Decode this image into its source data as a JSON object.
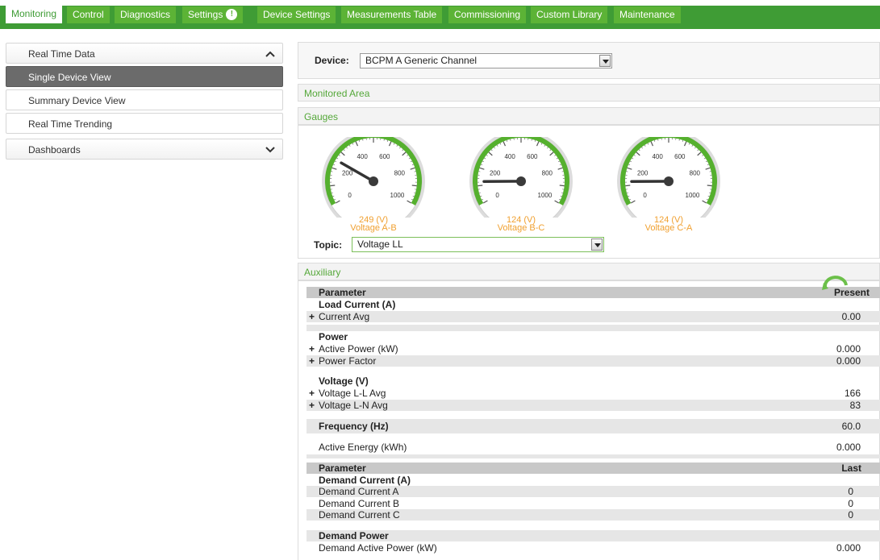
{
  "tabs": [
    {
      "label": "Monitoring",
      "active": true
    },
    {
      "label": "Control"
    },
    {
      "label": "Diagnostics"
    },
    {
      "label": "Settings",
      "badge": "!"
    },
    {
      "label": "Device Settings"
    },
    {
      "label": "Measurements Table"
    },
    {
      "label": "Commissioning"
    },
    {
      "label": "Custom Library"
    },
    {
      "label": "Maintenance"
    }
  ],
  "sidebar": {
    "realtime": "Real Time Data",
    "single": "Single Device View",
    "summary": "Summary Device View",
    "trending": "Real Time Trending",
    "dashboards": "Dashboards"
  },
  "device": {
    "label": "Device:",
    "value": "BCPM A Generic Channel"
  },
  "sections": {
    "monitored": "Monitored Area",
    "gauges": "Gauges",
    "auxiliary": "Auxiliary"
  },
  "gauges": [
    {
      "ticks": [
        "0",
        "200",
        "400",
        "600",
        "800",
        "1000"
      ],
      "value": 249,
      "reading": "249 (V)",
      "name": "Voltage A-B",
      "max": 1000
    },
    {
      "ticks": [
        "0",
        "200",
        "400",
        "600",
        "800",
        "1000"
      ],
      "value": 124,
      "reading": "124 (V)",
      "name": "Voltage B-C",
      "max": 1000
    },
    {
      "ticks": [
        "0",
        "200",
        "400",
        "600",
        "800",
        "1000"
      ],
      "value": 124,
      "reading": "124 (V)",
      "name": "Voltage C-A",
      "max": 1000
    }
  ],
  "topic": {
    "label": "Topic:",
    "value": "Voltage LL"
  },
  "table1": {
    "param_header": "Parameter",
    "present_header": "Present",
    "load_current": "Load Current (A)",
    "current_avg": {
      "label": "Current Avg",
      "value": "0.00"
    },
    "power": "Power",
    "active_power": {
      "label": "Active Power (kW)",
      "value": "0.000"
    },
    "power_factor": {
      "label": "Power Factor",
      "value": "0.000"
    },
    "voltage": "Voltage (V)",
    "voltage_ll": {
      "label": "Voltage L-L Avg",
      "value": "166"
    },
    "voltage_ln": {
      "label": "Voltage L-N Avg",
      "value": "83"
    },
    "frequency": {
      "label": "Frequency (Hz)",
      "value": "60.0"
    },
    "active_energy": {
      "label": "Active Energy (kWh)",
      "value": "0.000"
    }
  },
  "table2": {
    "param_header": "Parameter",
    "last_header": "Last",
    "demand_current": "Demand Current (A)",
    "dc_a": {
      "label": "Demand Current A",
      "value": "0"
    },
    "dc_b": {
      "label": "Demand Current B",
      "value": "0"
    },
    "dc_c": {
      "label": "Demand Current C",
      "value": "0"
    },
    "demand_power": "Demand Power",
    "dap": {
      "label": "Demand Active Power (kW)",
      "value": "0.000"
    }
  },
  "colors": {
    "brand": "#3f9c35",
    "tab": "#5cb336",
    "accent": "#f0a030",
    "gauge_ring": "#55b02e"
  }
}
